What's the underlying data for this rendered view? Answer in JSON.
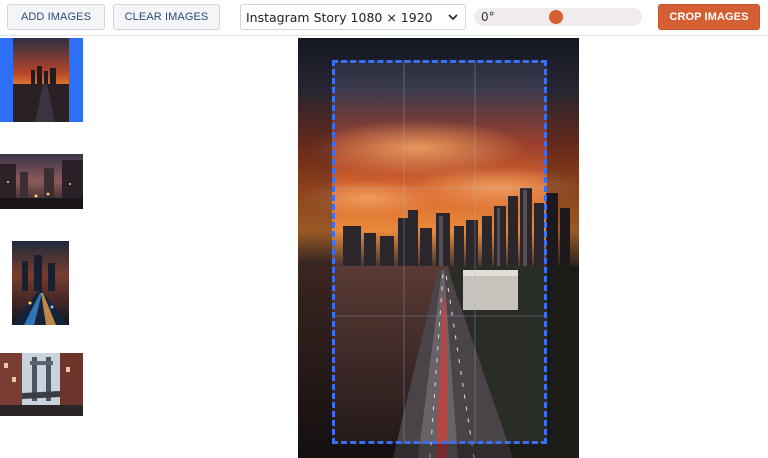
{
  "toolbar": {
    "add_label": "ADD IMAGES",
    "clear_label": "CLEAR IMAGES",
    "crop_label": "CROP IMAGES",
    "preset_selected": "Instagram Story 1080 × 1920",
    "rotation_label": "0°",
    "rotation_fraction": 0.49
  },
  "thumbnails": [
    {
      "name": "city sunset pier",
      "selected": true
    },
    {
      "name": "city street night",
      "selected": false
    },
    {
      "name": "city lights aerial",
      "selected": false
    },
    {
      "name": "bridge street",
      "selected": false
    }
  ],
  "colors": {
    "accent": "#d35f33",
    "selection": "#2d6ff7",
    "crop_border": "#3b6ff2"
  },
  "icons": {
    "dropdown": "chevron-down-icon"
  }
}
